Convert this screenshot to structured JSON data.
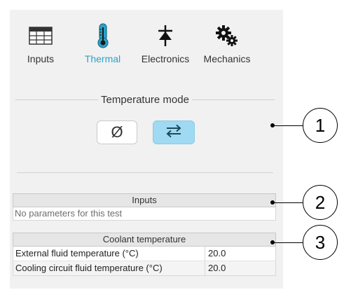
{
  "tabs": [
    {
      "label": "Inputs",
      "icon": "table-icon"
    },
    {
      "label": "Thermal",
      "icon": "thermometer-icon",
      "active": true
    },
    {
      "label": "Electronics",
      "icon": "diode-icon"
    },
    {
      "label": "Mechanics",
      "icon": "gears-icon"
    }
  ],
  "temperature_mode": {
    "title": "Temperature mode",
    "options": [
      {
        "symbol": "Ø",
        "icon": "empty-set-icon",
        "selected": false
      },
      {
        "symbol": "⇄",
        "icon": "swap-arrows-icon",
        "selected": true
      }
    ]
  },
  "inputs_section": {
    "header": "Inputs",
    "note": "No parameters for this test"
  },
  "coolant_section": {
    "header": "Coolant temperature",
    "rows": [
      {
        "name": "External fluid temperature (°C)",
        "value": "20.0"
      },
      {
        "name": "Cooling circuit fluid temperature (°C)",
        "value": "20.0"
      }
    ]
  },
  "callouts": [
    "1",
    "2",
    "3"
  ],
  "colors": {
    "accent": "#2aa3c9",
    "selected_button": "#9fd9f2",
    "panel": "#f1f1f1"
  }
}
